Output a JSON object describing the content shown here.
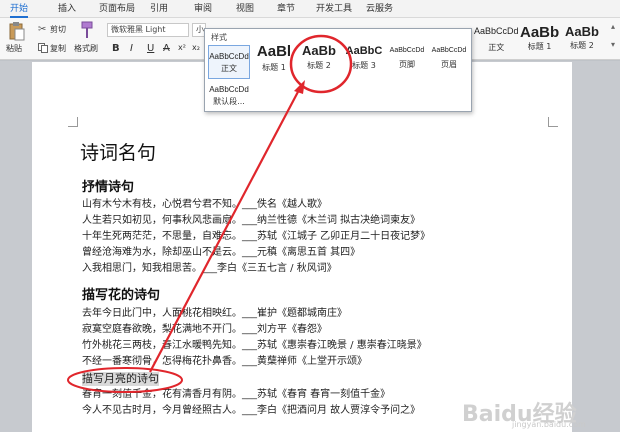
{
  "tabs": [
    "开始",
    "插入",
    "页面布局",
    "引用",
    "审阅",
    "视图",
    "章节",
    "开发工具",
    "云服务"
  ],
  "toolbar": {
    "paste": "粘贴",
    "cut": "剪切",
    "copy": "复制",
    "format_painter": "格式刷",
    "font_name": "微软雅黑 Light",
    "font_size": "小",
    "bold": "B",
    "italic": "I",
    "underline": "U",
    "strike": "A",
    "super": "x²",
    "sub": "x₂"
  },
  "ribbon_styles": [
    {
      "sample": "AaBbCcDd",
      "label": "正文"
    },
    {
      "sample": "AaBb",
      "label": "标题 1"
    },
    {
      "sample": "AaBb",
      "label": "标题 2"
    }
  ],
  "style_popup": {
    "title": "样式",
    "items": [
      {
        "sample": "AaBbCcDd",
        "label": "正文"
      },
      {
        "sample": "AaBl",
        "label": "标题 1"
      },
      {
        "sample": "AaBb",
        "label": "标题 2"
      },
      {
        "sample": "AaBbC",
        "label": "标题 3"
      },
      {
        "sample": "AaBbCcDd",
        "label": "页脚"
      },
      {
        "sample": "AaBbCcDd",
        "label": "页眉"
      },
      {
        "sample": "AaBbCcDd",
        "label": "默认段..."
      }
    ]
  },
  "document": {
    "title": "诗词名句",
    "sections": [
      {
        "heading": "抒情诗句",
        "lines": [
          "山有木兮木有枝，心悦君兮君不知。___佚名《越人歌》",
          "人生若只如初见，何事秋风悲画扇。___纳兰性德《木兰词 拟古决绝词柬友》",
          "十年生死两茫茫，不思量，自难忘。___苏轼《江城子 乙卯正月二十日夜记梦》",
          "曾经沧海难为水，除却巫山不是云。___元稹《离思五首 其四》",
          "入我相思门，知我相思苦。___李白《三五七言 / 秋风词》"
        ]
      },
      {
        "heading": "描写花的诗句",
        "lines": [
          "去年今日此门中，人面桃花相映红。___崔护《题都城南庄》",
          "寂寞空庭春欲晚，梨花满地不开门。___刘方平《春怨》",
          "竹外桃花三两枝，春江水暖鸭先知。___苏轼《惠崇春江晚景 / 惠崇春江晓景》",
          "不经一番寒彻骨，怎得梅花扑鼻香。___黄蘖禅师《上堂开示颂》"
        ]
      },
      {
        "heading": "描写月亮的诗句",
        "lines": [
          "春宵一刻值千金，花有清香月有阴。___苏轼《春宵 春宵一刻值千金》",
          "今人不见古时月，今月曾经照古人。___李白《把酒问月 故人贾淳令予问之》"
        ]
      }
    ]
  },
  "watermark": "Baidu经验",
  "watermark_sub": "jingyan.baidu.com",
  "colors": {
    "accent": "#1f6fd1",
    "annotation": "#e0262c"
  }
}
